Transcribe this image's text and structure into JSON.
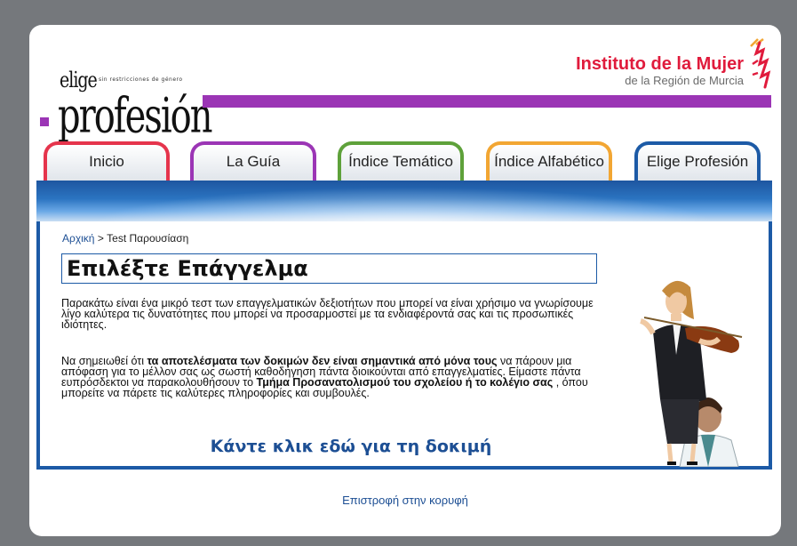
{
  "header": {
    "logo_top": "elige",
    "logo_tagline": "sin restricciones de género",
    "logo_main": "profesión",
    "institution_title": "Instituto de la Mujer",
    "institution_subtitle": "de la Región de Murcia"
  },
  "tabs": [
    {
      "label": "Inicio",
      "color": "#e5344c"
    },
    {
      "label": "La Guía",
      "color": "#9b35b5"
    },
    {
      "label": "Índice Temático",
      "color": "#5ea13a"
    },
    {
      "label": "Índice Alfabético",
      "color": "#f2a633"
    },
    {
      "label": "Elige Profesión",
      "color": "#1c5aa6"
    }
  ],
  "breadcrumb": {
    "home": "Αρχική",
    "separator": ">",
    "current": "Test Παρουσίαση"
  },
  "main": {
    "title": "Επιλέξτε Επάγγελμα",
    "paragraph1": "Παρακάτω είναι ένα μικρό τεστ των επαγγελματικών δεξιοτήτων που μπορεί να είναι χρήσιμο να γνωρίσουμε λίγο καλύτερα τις δυνατότητες που μπορεί να προσαρμοστεί με τα ενδιαφέροντά σας και τις προσωπικές ιδιότητες.",
    "p2_a": "Να σημειωθεί ότι ",
    "p2_b": "τα αποτελέσματα των δοκιμών δεν είναι σημαντικά από μόνα τους",
    "p2_c": " να πάρουν μια απόφαση για το μέλλον σας ως σωστή καθοδήγηση πάντα διοικούνται από επαγγελματίες. Είμαστε πάντα ευπρόσδεκτοι να παρακολουθήσουν το ",
    "p2_d": "Τμήμα Προσανατολισμού του σχολείου ή το κολέγιο σας",
    "p2_e": " , όπου μπορείτε να πάρετε τις καλύτερες πληροφορίες και συμβουλές.",
    "cta": "Κάντε κλικ εδώ για τη δοκιμή"
  },
  "footer": {
    "back_to_top": "Επιστροφή στην κορυφή"
  },
  "colors": {
    "background": "#75787c",
    "accent_purple": "#9b35b5",
    "accent_blue": "#1c5aa6",
    "institution_red": "#e01b3c",
    "link_blue": "#1d4f94"
  }
}
